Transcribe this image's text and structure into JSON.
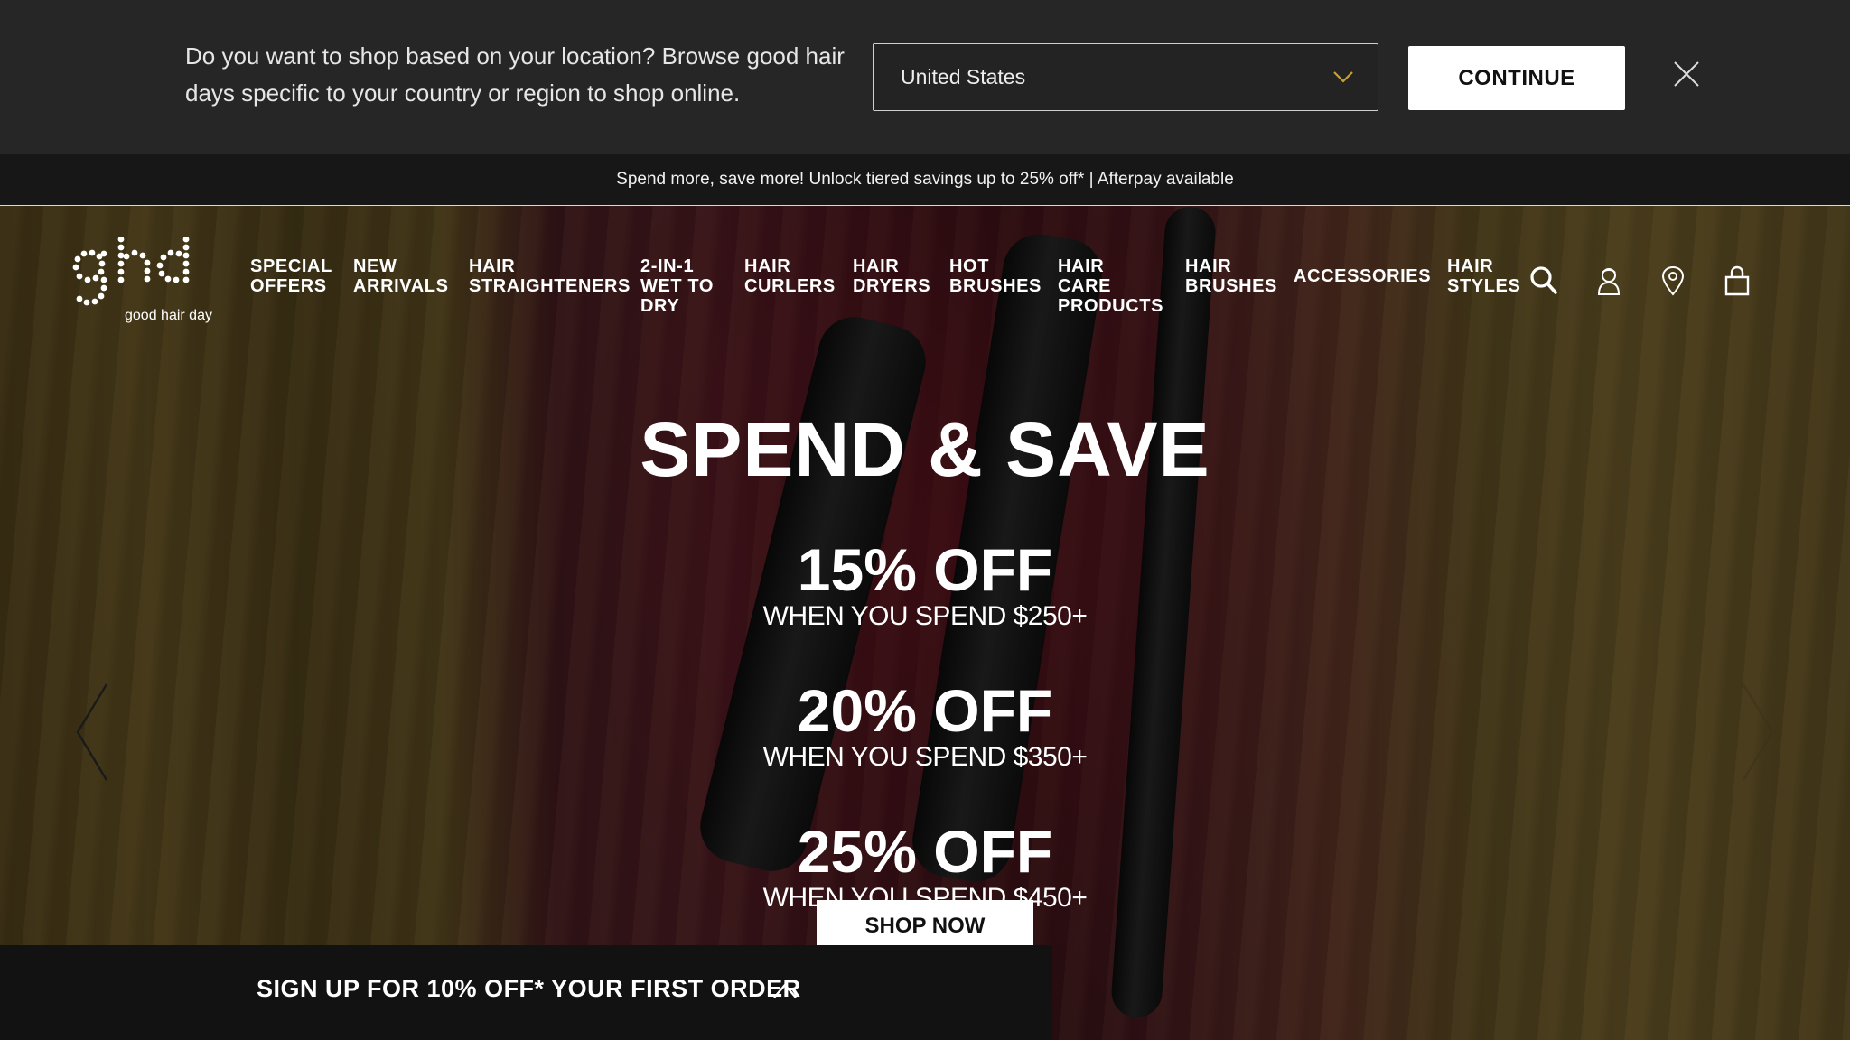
{
  "location_banner": {
    "message": "Do you want to shop based on your location? Browse good hair days specific to your country or region to shop online.",
    "selected_country": "United States",
    "continue_label": "CONTINUE"
  },
  "promo": {
    "text": "Spend more, save more! Unlock tiered savings up to 25% off* | Afterpay available"
  },
  "header": {
    "logo_tagline": "good hair day",
    "nav": [
      {
        "line1": "SPECIAL",
        "line2": "OFFERS",
        "line3": ""
      },
      {
        "line1": "NEW",
        "line2": "ARRIVALS",
        "line3": ""
      },
      {
        "line1": "HAIR",
        "line2": "STRAIGHTENERS",
        "line3": ""
      },
      {
        "line1": "2-IN-1",
        "line2": "WET TO",
        "line3": "DRY"
      },
      {
        "line1": "HAIR",
        "line2": "CURLERS",
        "line3": ""
      },
      {
        "line1": "HAIR",
        "line2": "DRYERS",
        "line3": ""
      },
      {
        "line1": "HOT",
        "line2": "BRUSHES",
        "line3": ""
      },
      {
        "line1": "HAIR",
        "line2": "CARE",
        "line3": "PRODUCTS"
      },
      {
        "line1": "HAIR",
        "line2": "BRUSHES",
        "line3": ""
      },
      {
        "line1": "ACCESSORIES",
        "line2": "",
        "line3": ""
      },
      {
        "line1": "HAIR",
        "line2": "STYLES",
        "line3": ""
      }
    ]
  },
  "hero": {
    "title": "SPEND & SAVE",
    "tiers": [
      {
        "off": "15% OFF",
        "condition": "WHEN YOU SPEND $250+"
      },
      {
        "off": "20% OFF",
        "condition": "WHEN YOU SPEND $350+"
      },
      {
        "off": "25% OFF",
        "condition": "WHEN YOU SPEND $450+"
      }
    ],
    "cta": "SHOP NOW"
  },
  "signup": {
    "label": "SIGN UP FOR 10% OFF* YOUR FIRST ORDER"
  },
  "icons": {
    "search": "search-icon",
    "account": "account-icon",
    "store_locator": "location-pin-icon",
    "bag": "shopping-bag-icon",
    "close": "close-icon",
    "dropdown": "chevron-down-icon",
    "prev": "chevron-left-icon",
    "next": "chevron-right-icon",
    "expand": "chevron-up-icon"
  },
  "colors": {
    "banner_bg": "#262626",
    "dropdown_chevron": "#c9a227",
    "promo_bg": "#171717"
  }
}
